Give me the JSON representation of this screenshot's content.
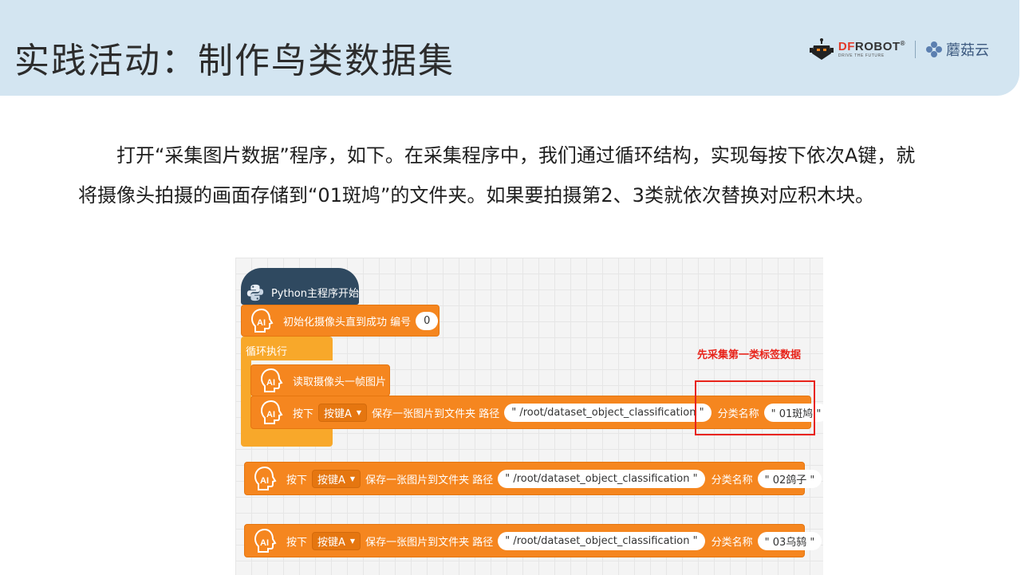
{
  "header": {
    "title": "实践活动：制作鸟类数据集",
    "dfrobot": {
      "brand_prefix": "DF",
      "brand_rest": "ROBOT",
      "registered": "®",
      "tagline": "DRIVE THE FUTURE"
    },
    "mushroom": {
      "name": "蘑菇云"
    }
  },
  "paragraph": {
    "text": "打开“采集图片数据”程序，如下。在采集程序中，我们通过循环结构，实现每按下依次A键，就将摄像头拍摄的画面存储到“01斑鸠”的文件夹。如果要拍摄第2、3类就依次替换对应积木块。"
  },
  "blocks": {
    "start_label": "Python主程序开始",
    "init_label": "初始化摄像头直到成功 编号",
    "init_value": "0",
    "loop_label": "循环执行",
    "read_label": "读取摄像头一帧图片",
    "press_label": "按下",
    "key_option": "按键A",
    "save_label": "保存一张图片到文件夹 路径",
    "path_value": "\" /root/dataset_object_classification \"",
    "class_label": "分类名称",
    "class_1": "\" 01斑鸠 \"",
    "class_2": "\" 02鸽子 \"",
    "class_3": "\" 03乌鸫 \""
  },
  "annotation": "先采集第一类标签数据",
  "colors": {
    "header_bg": "#d3e5f1",
    "block_orange": "#f5861f",
    "loop_orange": "#f8a82a",
    "start_navy": "#2f4960",
    "annotation_red": "#e8231a"
  }
}
